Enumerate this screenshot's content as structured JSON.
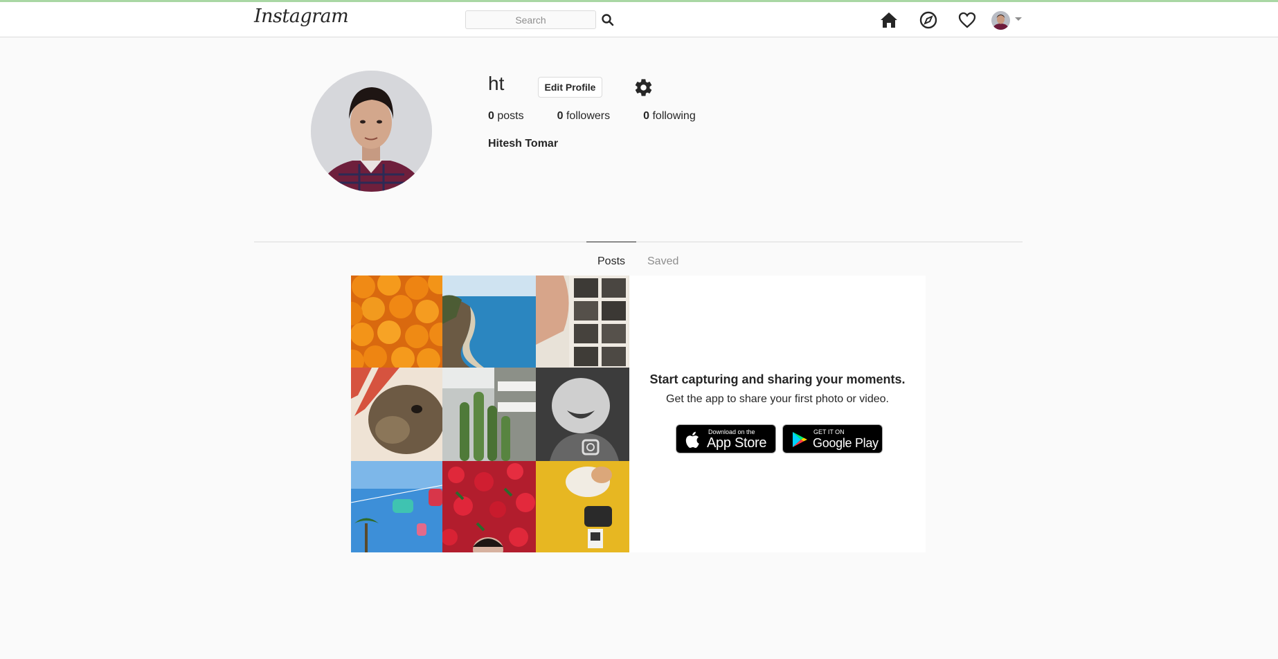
{
  "header": {
    "logo": "Instagram",
    "search_placeholder": "Search",
    "icons": [
      "home-icon",
      "compass-icon",
      "heart-icon",
      "avatar",
      "caret-down-icon"
    ]
  },
  "profile": {
    "username": "ht",
    "edit_label": "Edit Profile",
    "full_name": "Hitesh Tomar",
    "stats": {
      "posts_count": "0",
      "posts_label": "posts",
      "followers_count": "0",
      "followers_label": "followers",
      "following_count": "0",
      "following_label": "following"
    }
  },
  "tabs": {
    "posts": "Posts",
    "saved": "Saved"
  },
  "promo": {
    "title": "Start capturing and sharing your moments.",
    "subtitle": "Get the app to share your first photo or video.",
    "app_store": {
      "small": "Download on the",
      "big": "App Store"
    },
    "google_play": {
      "small": "GET IT ON",
      "big": "Google Play"
    }
  },
  "grid_images": [
    "oranges",
    "coastline",
    "photo-strip",
    "dog",
    "cactus",
    "baby",
    "ferris-ride",
    "red-flowers",
    "cat"
  ],
  "colors": {
    "background": "#fafafa",
    "border": "#dbdbdb",
    "text": "#262626",
    "muted": "#8e8e8e"
  }
}
